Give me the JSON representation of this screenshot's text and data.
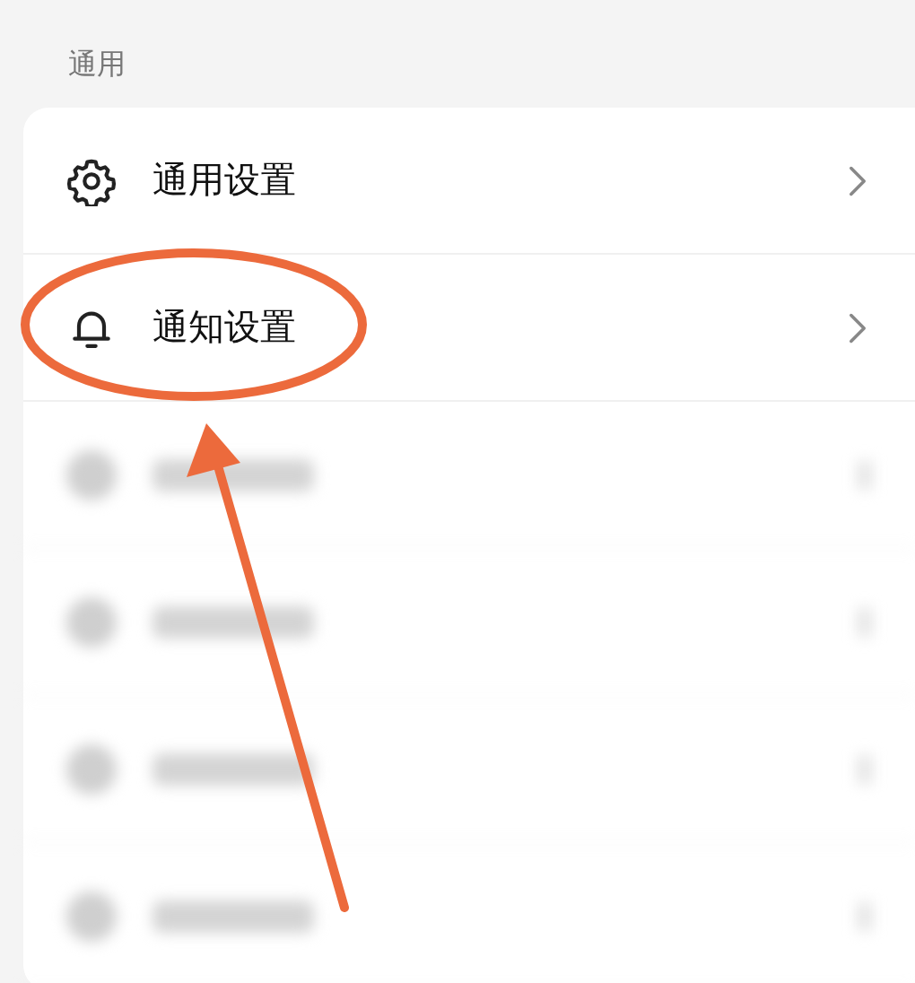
{
  "section": {
    "title": "通用"
  },
  "items": [
    {
      "kind": "setting",
      "label": "通用设置"
    },
    {
      "kind": "setting",
      "label": "通知设置"
    },
    {
      "kind": "blurred"
    },
    {
      "kind": "blurred"
    },
    {
      "kind": "blurred"
    },
    {
      "kind": "blurred"
    }
  ],
  "annotation": {
    "kind": "circle-and-arrow"
  }
}
